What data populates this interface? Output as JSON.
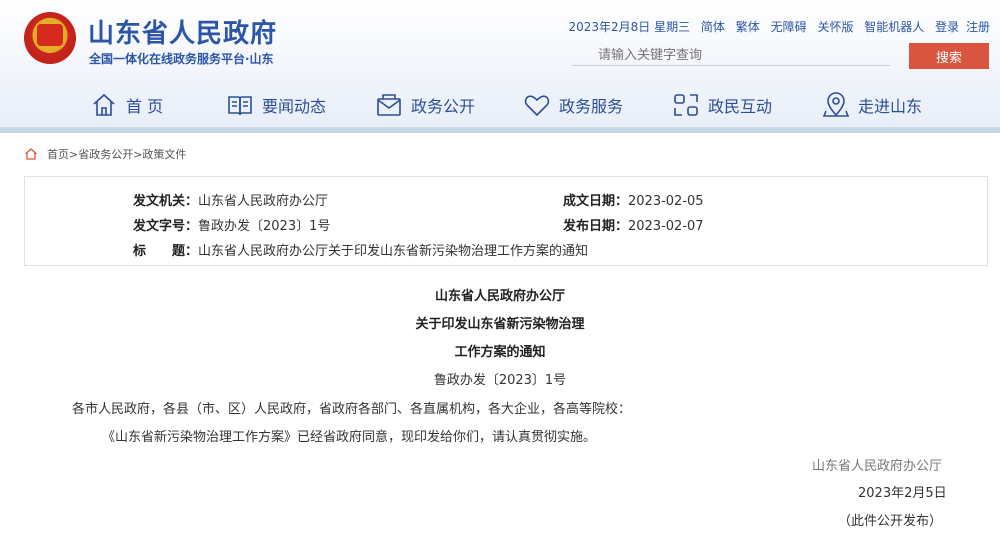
{
  "header": {
    "site_title": "山东省人民政府",
    "site_subtitle": "全国一体化在线政务服务平台·山东",
    "top_links": {
      "date": "2023年2月8日 星期三",
      "simplified": "简体",
      "traditional": "繁体",
      "accessibility": "无障碍",
      "care_mode": "关怀版",
      "robot": "智能机器人",
      "login": "登录",
      "register": "注册"
    },
    "search": {
      "placeholder": "请输入关键字查询",
      "button": "搜索"
    },
    "accent": "#2b56a8",
    "search_button_color": "#d9553f"
  },
  "nav": [
    {
      "label": "首 页",
      "icon": "home-icon"
    },
    {
      "label": "要闻动态",
      "icon": "book-icon"
    },
    {
      "label": "政务公开",
      "icon": "envelope-icon"
    },
    {
      "label": "政务服务",
      "icon": "heart-icon"
    },
    {
      "label": "政民互动",
      "icon": "interaction-icon"
    },
    {
      "label": "走进山东",
      "icon": "map-pin-icon"
    }
  ],
  "breadcrumb": "首页>省政务公开>政策文件",
  "meta": {
    "issuer_label": "发文机关：",
    "issuer": "山东省人民政府办公厅",
    "created_label": "成文日期：",
    "created": "2023-02-05",
    "doc_no_label": "发文字号：",
    "doc_no": "鲁政办发〔2023〕1号",
    "published_label": "发布日期：",
    "published": "2023-02-07",
    "title_label": "标　　题：",
    "title": "山东省人民政府办公厅关于印发山东省新污染物治理工作方案的通知"
  },
  "document": {
    "title_line1": "山东省人民政府办公厅",
    "title_line2": "关于印发山东省新污染物治理",
    "title_line3": "工作方案的通知",
    "number": "鲁政办发〔2023〕1号",
    "addressees": "各市人民政府，各县（市、区）人民政府，省政府各部门、各直属机构，各大企业，各高等院校：",
    "content": "《山东省新污染物治理工作方案》已经省政府同意，现印发给你们，请认真贯彻实施。",
    "signer": "山东省人民政府办公厅",
    "sign_date": "2023年2月5日",
    "publish_note": "（此件公开发布）"
  }
}
